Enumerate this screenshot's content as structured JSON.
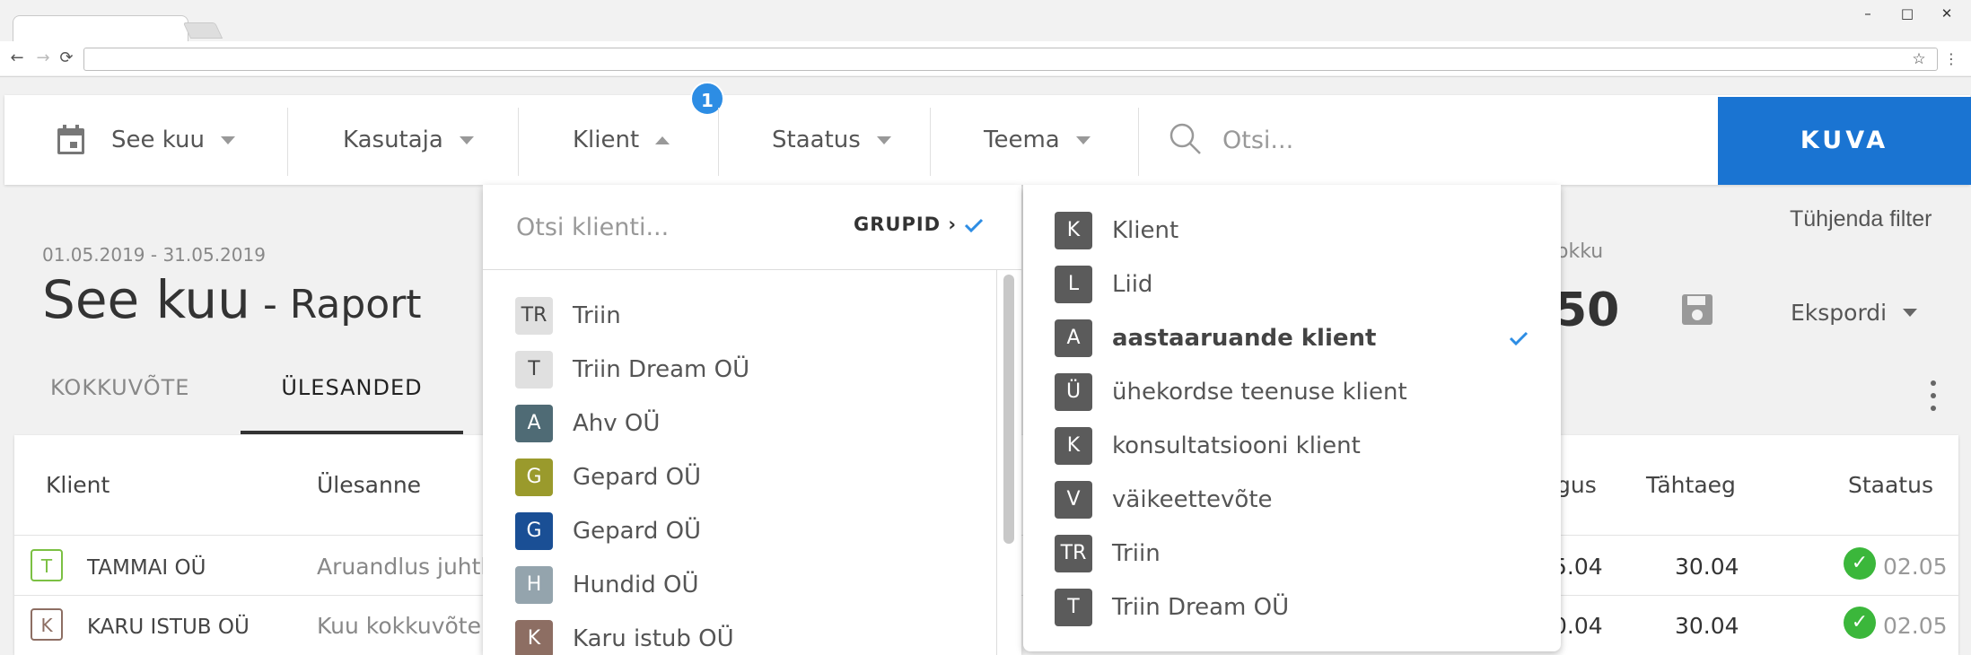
{
  "browser": {
    "window_controls": {
      "minimize": "–",
      "maximize": "□",
      "close": "✕"
    },
    "nav": {
      "back": "←",
      "forward": "→",
      "reload": "⟳"
    },
    "url": "",
    "star": "☆",
    "menu": "⋮"
  },
  "filters": {
    "period_label": "See kuu",
    "user_label": "Kasutaja",
    "client_label": "Klient",
    "client_badge": "1",
    "status_label": "Staatus",
    "theme_label": "Teema",
    "search_placeholder": "Otsi...",
    "show_button": "KUVA"
  },
  "page": {
    "date_range": "01.05.2019 - 31.05.2019",
    "title": "See kuu",
    "title_suffix": " - Raport",
    "clear_filter": "Tühjenda filter",
    "total_label": "okku",
    "total_value": "50",
    "export_label": "Ekspordi"
  },
  "tabs": [
    {
      "label": "KOKKUVÕTE"
    },
    {
      "label": "ÜLESANDED"
    }
  ],
  "table": {
    "headers": {
      "client": "Klient",
      "task": "Ülesanne",
      "duration": "gus",
      "deadline": "Tähtaeg",
      "status": "Staatus"
    },
    "rows": [
      {
        "letter": "T",
        "client": "TAMMAI OÜ",
        "task": "Aruandlus juhtk",
        "duration": "5.04",
        "deadline": "30.04",
        "status_date": "02.05",
        "letter_color": "#7bc043"
      },
      {
        "letter": "K",
        "client": "KARU ISTUB OÜ",
        "task": "Kuu kokkuvõte",
        "duration": "0.04",
        "deadline": "30.04",
        "status_date": "02.05",
        "letter_color": "#8d6e63"
      }
    ]
  },
  "client_dropdown": {
    "search_placeholder": "Otsi klienti...",
    "groups_label": "GRUPID ›",
    "items": [
      {
        "initials": "TR",
        "name": "Triin",
        "color": "#e0e0e0",
        "text_color": "#444"
      },
      {
        "initials": "T",
        "name": "Triin Dream OÜ",
        "color": "#e0e0e0",
        "text_color": "#444"
      },
      {
        "initials": "A",
        "name": "Ahv OÜ",
        "color": "#4f6b75",
        "text_color": "#ffffff"
      },
      {
        "initials": "G",
        "name": "Gepard OÜ",
        "color": "#9a9a2c",
        "text_color": "#ffffff"
      },
      {
        "initials": "G",
        "name": "Gepard OÜ",
        "color": "#1a4f95",
        "text_color": "#ffffff"
      },
      {
        "initials": "H",
        "name": "Hundid OÜ",
        "color": "#94a4ad",
        "text_color": "#ffffff"
      },
      {
        "initials": "K",
        "name": "Karu istub OÜ",
        "color": "#8d6e63",
        "text_color": "#ffffff"
      }
    ]
  },
  "group_dropdown": {
    "items": [
      {
        "initials": "K",
        "name": "Klient",
        "selected": false
      },
      {
        "initials": "L",
        "name": "Liid",
        "selected": false
      },
      {
        "initials": "A",
        "name": "aastaaruande klient",
        "selected": true
      },
      {
        "initials": "Ü",
        "name": "ühekordse teenuse klient",
        "selected": false
      },
      {
        "initials": "K",
        "name": "konsultatsiooni klient",
        "selected": false
      },
      {
        "initials": "V",
        "name": "väikeettevõte",
        "selected": false
      },
      {
        "initials": "TR",
        "name": "Triin",
        "selected": false
      },
      {
        "initials": "T",
        "name": "Triin Dream OÜ",
        "selected": false
      }
    ]
  },
  "colors": {
    "accent": "#1a74d2",
    "badge": "#2d8de4",
    "status_ok": "#3bb73b"
  }
}
